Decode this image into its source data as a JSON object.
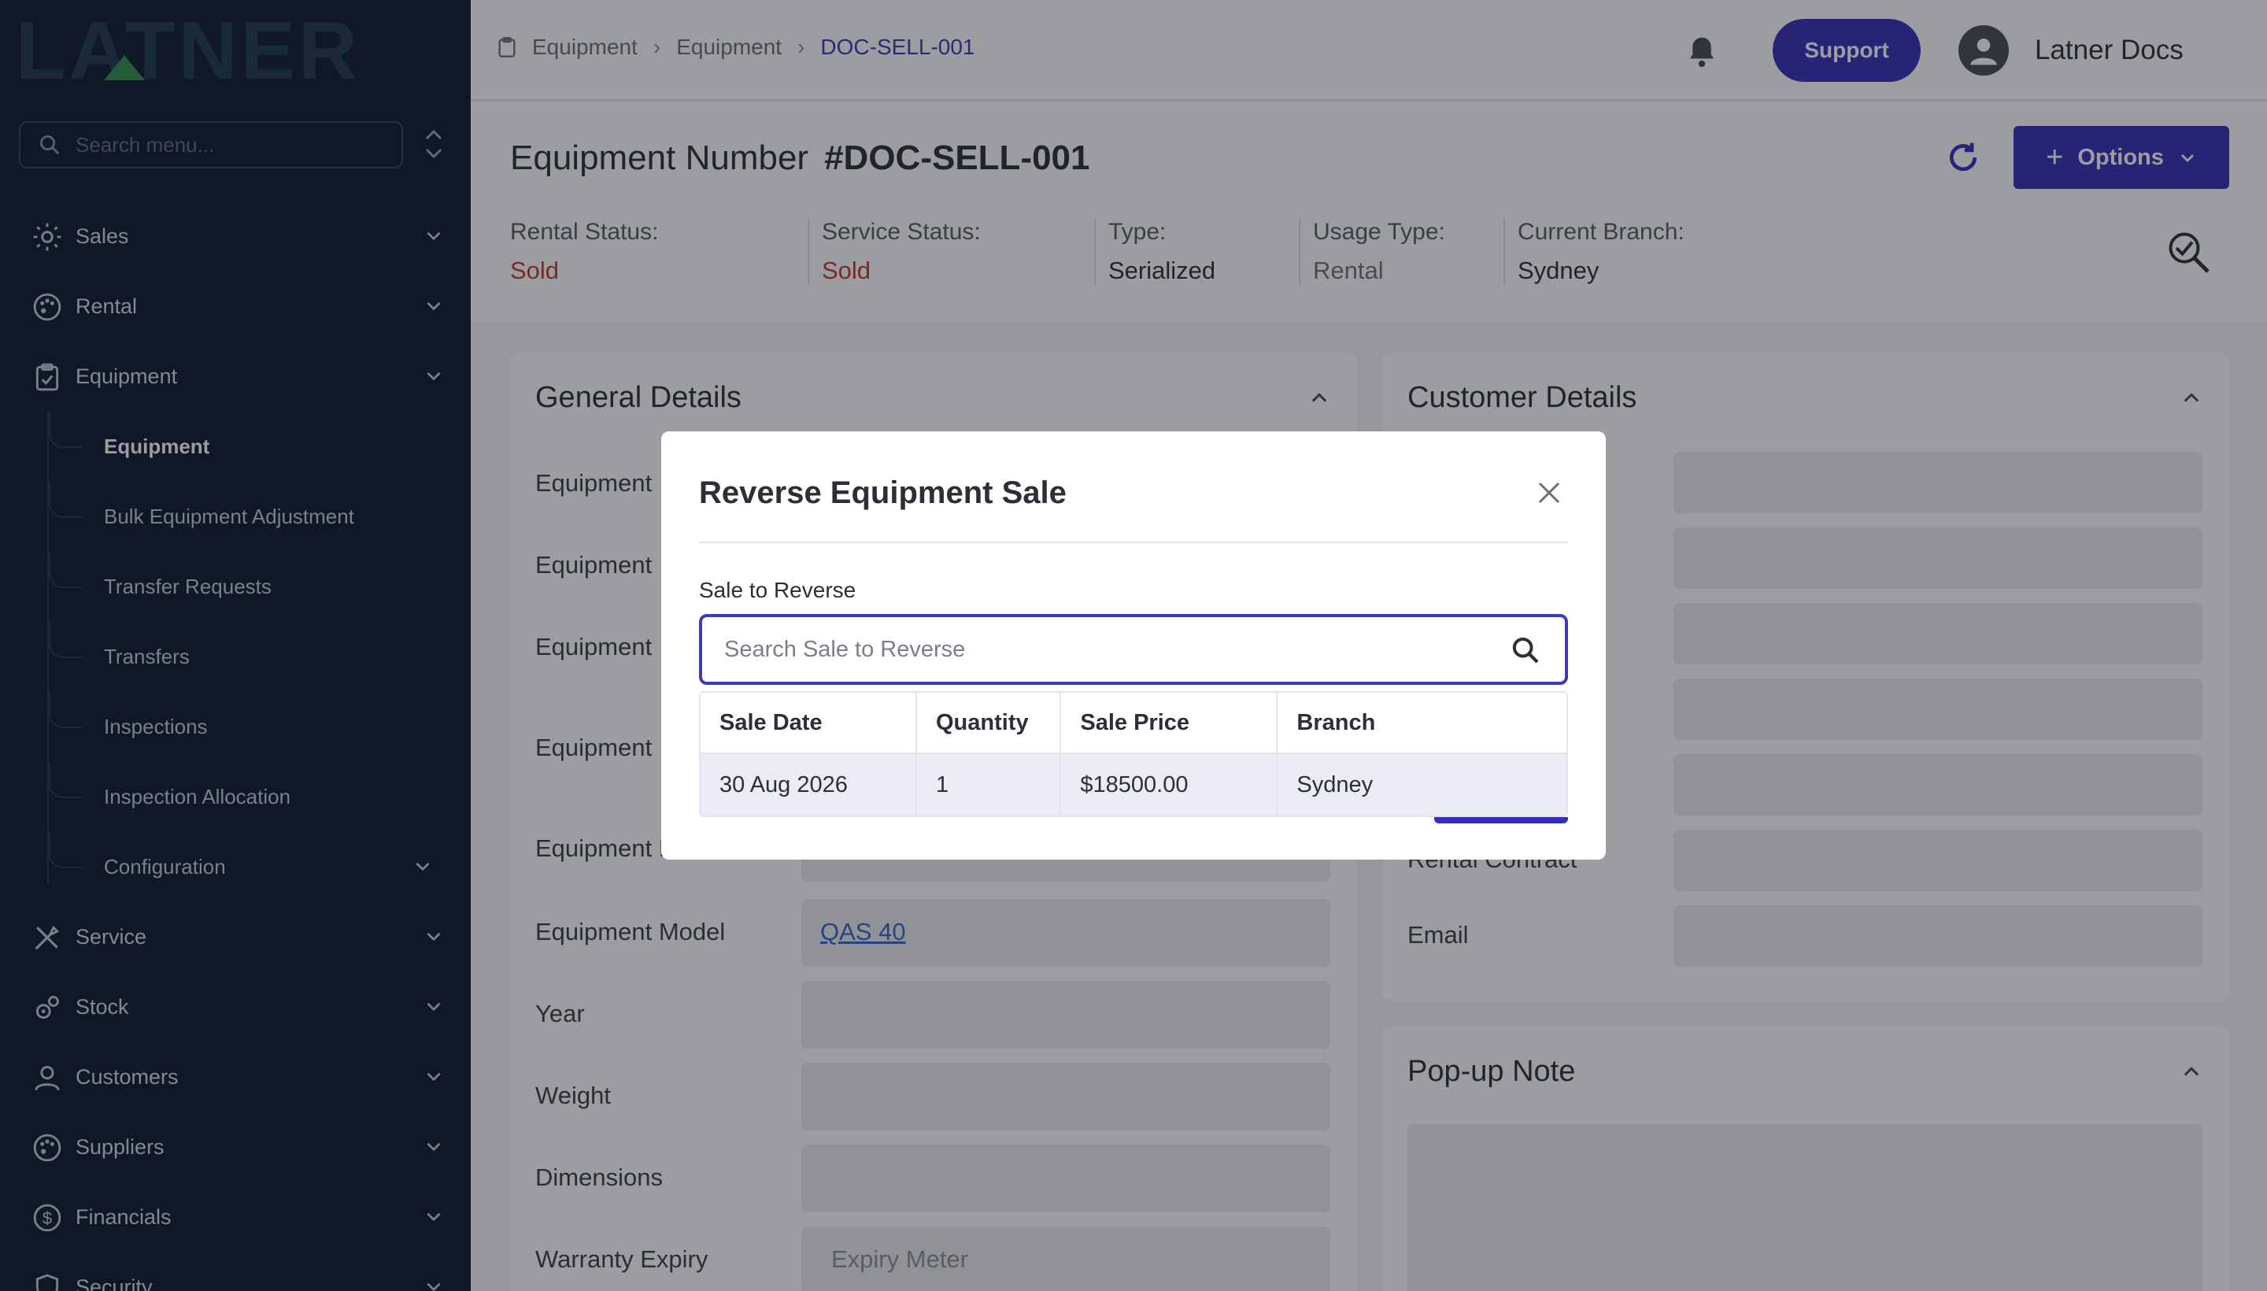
{
  "sidebar": {
    "logo_text": "LATNER",
    "search_placeholder": "Search menu...",
    "items": [
      {
        "label": "Sales"
      },
      {
        "label": "Rental"
      },
      {
        "label": "Equipment"
      }
    ],
    "equipment_sub": [
      {
        "label": "Equipment"
      },
      {
        "label": "Bulk Equipment Adjustment"
      },
      {
        "label": "Transfer Requests"
      },
      {
        "label": "Transfers"
      },
      {
        "label": "Inspections"
      },
      {
        "label": "Inspection Allocation"
      },
      {
        "label": "Configuration"
      }
    ],
    "items_after": [
      {
        "label": "Service"
      },
      {
        "label": "Stock"
      },
      {
        "label": "Customers"
      },
      {
        "label": "Suppliers"
      },
      {
        "label": "Financials"
      },
      {
        "label": "Security"
      }
    ]
  },
  "topbar": {
    "crumbs": [
      "Equipment",
      "Equipment",
      "DOC-SELL-001"
    ],
    "support_label": "Support",
    "user_name": "Latner Docs"
  },
  "header": {
    "title_prefix": "Equipment Number",
    "title_number": "#DOC-SELL-001",
    "options_label": "Options",
    "statuses": [
      {
        "key": "Rental Status:",
        "value": "Sold"
      },
      {
        "key": "Service Status:",
        "value": "Sold"
      },
      {
        "key": "Type:",
        "value": "Serialized"
      },
      {
        "key": "Usage Type:",
        "value": "Rental"
      },
      {
        "key": "Current Branch:",
        "value": "Sydney"
      }
    ]
  },
  "general": {
    "title": "General Details",
    "labels": [
      "Equipment",
      "Equipment",
      "Equipment",
      "Equipment",
      "Equipment Name",
      "Equipment Model",
      "Year",
      "Weight",
      "Dimensions",
      "Warranty Expiry"
    ],
    "model_value": "QAS 40",
    "warranty_placeholder": "Expiry Meter"
  },
  "customer": {
    "title": "Customer Details",
    "labels": [
      "Rental Contract",
      "Email"
    ]
  },
  "popup": {
    "title": "Pop-up Note"
  },
  "modal": {
    "title": "Reverse Equipment Sale",
    "field_label": "Sale to Reverse",
    "placeholder": "Search Sale to Reverse",
    "columns": [
      "Sale Date",
      "Quantity",
      "Sale Price",
      "Branch"
    ],
    "rows": [
      [
        "30 Aug 2026",
        "1",
        "$18500.00",
        "Sydney"
      ]
    ]
  },
  "colors": {
    "primary": "#3630b8",
    "sidebar_bg": "#0f1a2e",
    "status_red": "#c0392b"
  }
}
